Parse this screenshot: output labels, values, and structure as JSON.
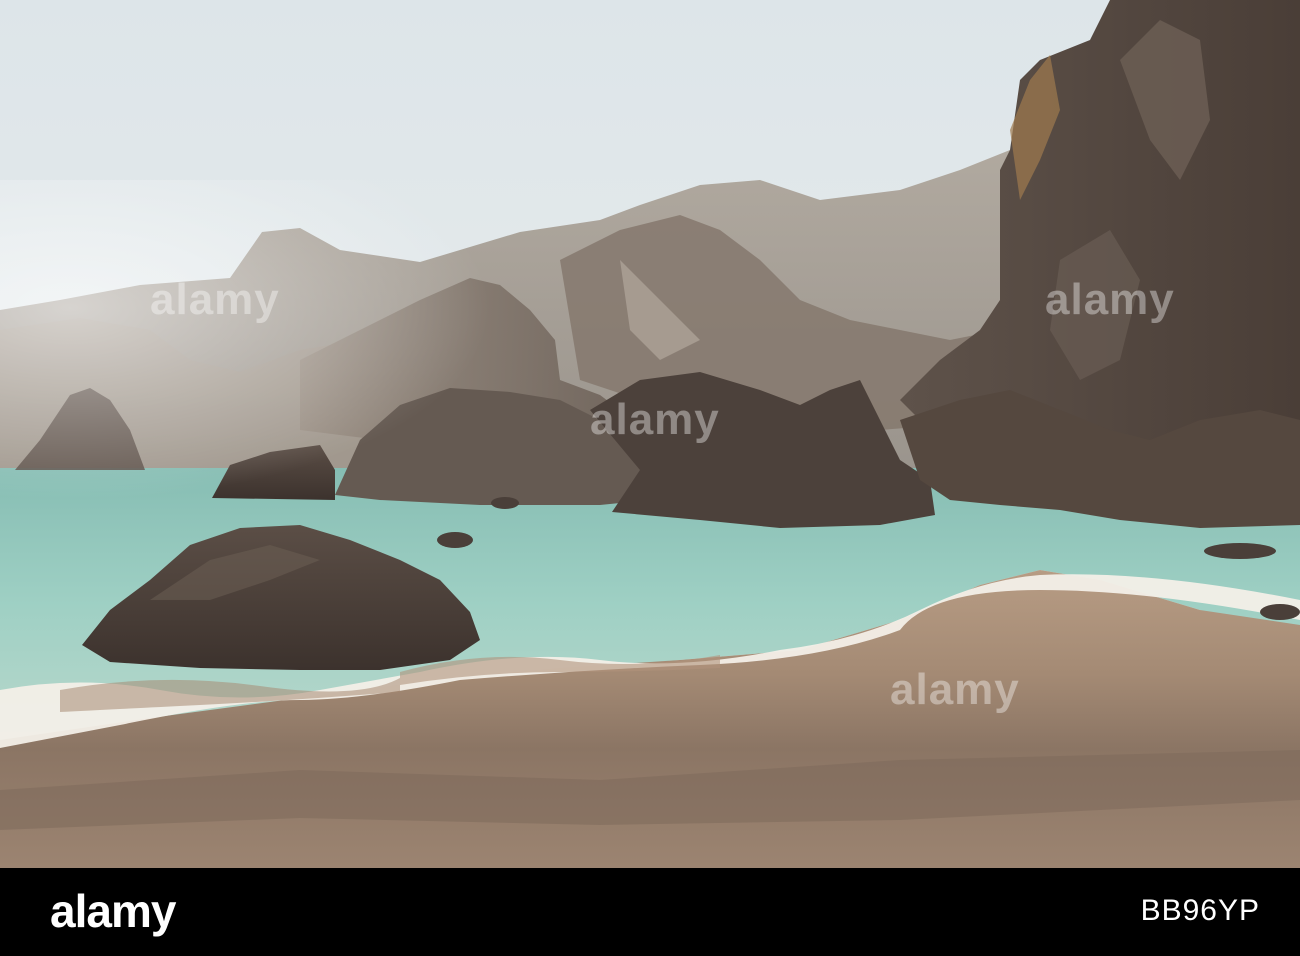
{
  "photo": {
    "subject": "",
    "watermark": "alamy"
  },
  "footer": {
    "logo": "alamy",
    "image_code": "BB96YP"
  },
  "colors": {
    "sky_top": "#dfe6ea",
    "sky_bottom": "#eef1f2",
    "sea": "#8fc6bb",
    "sand": "#a98f78",
    "cliff_dark": "#4a3f39",
    "cliff_mid": "#7f7368",
    "foam": "#f4f0ea"
  }
}
